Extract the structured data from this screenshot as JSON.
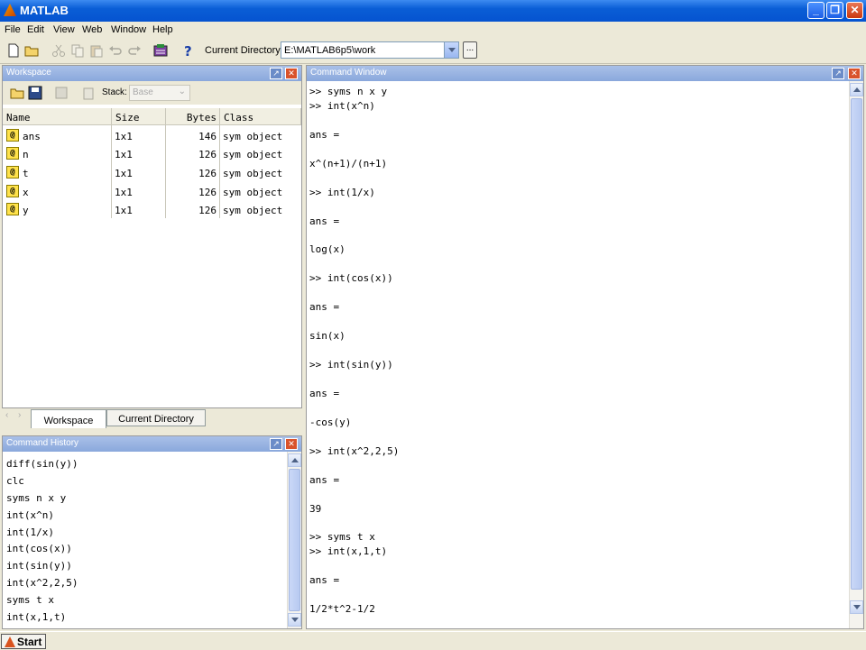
{
  "window": {
    "title": "MATLAB"
  },
  "menu": [
    "File",
    "Edit",
    "View",
    "Web",
    "Window",
    "Help"
  ],
  "toolbar": {
    "current_directory_label": "Current Directory:",
    "current_directory_value": "E:\\MATLAB6p5\\work",
    "browse_label": "..."
  },
  "workspace": {
    "title": "Workspace",
    "stack_label": "Stack:",
    "stack_value": "Base",
    "columns": [
      "Name",
      "Size",
      "Bytes",
      "Class"
    ],
    "rows": [
      {
        "name": "ans",
        "size": "1x1",
        "bytes": "146",
        "class": "sym object"
      },
      {
        "name": "n",
        "size": "1x1",
        "bytes": "126",
        "class": "sym object"
      },
      {
        "name": "t",
        "size": "1x1",
        "bytes": "126",
        "class": "sym object"
      },
      {
        "name": "x",
        "size": "1x1",
        "bytes": "126",
        "class": "sym object"
      },
      {
        "name": "y",
        "size": "1x1",
        "bytes": "126",
        "class": "sym object"
      }
    ],
    "tabs": [
      "Workspace",
      "Current Directory"
    ]
  },
  "history": {
    "title": "Command History",
    "items": [
      "diff(sin(y))",
      "clc",
      "syms n x y",
      "int(x^n)",
      "int(1/x)",
      "int(cos(x))",
      "int(sin(y))",
      "int(x^2,2,5)",
      "syms t x",
      "int(x,1,t)"
    ]
  },
  "command_window": {
    "title": "Command Window",
    "lines": [
      ">> syms n x y",
      ">> int(x^n)",
      "",
      "ans =",
      "",
      "x^(n+1)/(n+1)",
      "",
      ">> int(1/x)",
      "",
      "ans =",
      "",
      "log(x)",
      "",
      ">> int(cos(x))",
      "",
      "ans =",
      "",
      "sin(x)",
      "",
      ">> int(sin(y))",
      "",
      "ans =",
      "",
      "-cos(y)",
      "",
      ">> int(x^2,2,5)",
      "",
      "ans =",
      "",
      "39",
      "",
      ">> syms t x",
      ">> int(x,1,t)",
      "",
      "ans =",
      "",
      "1/2*t^2-1/2"
    ]
  },
  "taskbar": {
    "start_label": "Start"
  }
}
